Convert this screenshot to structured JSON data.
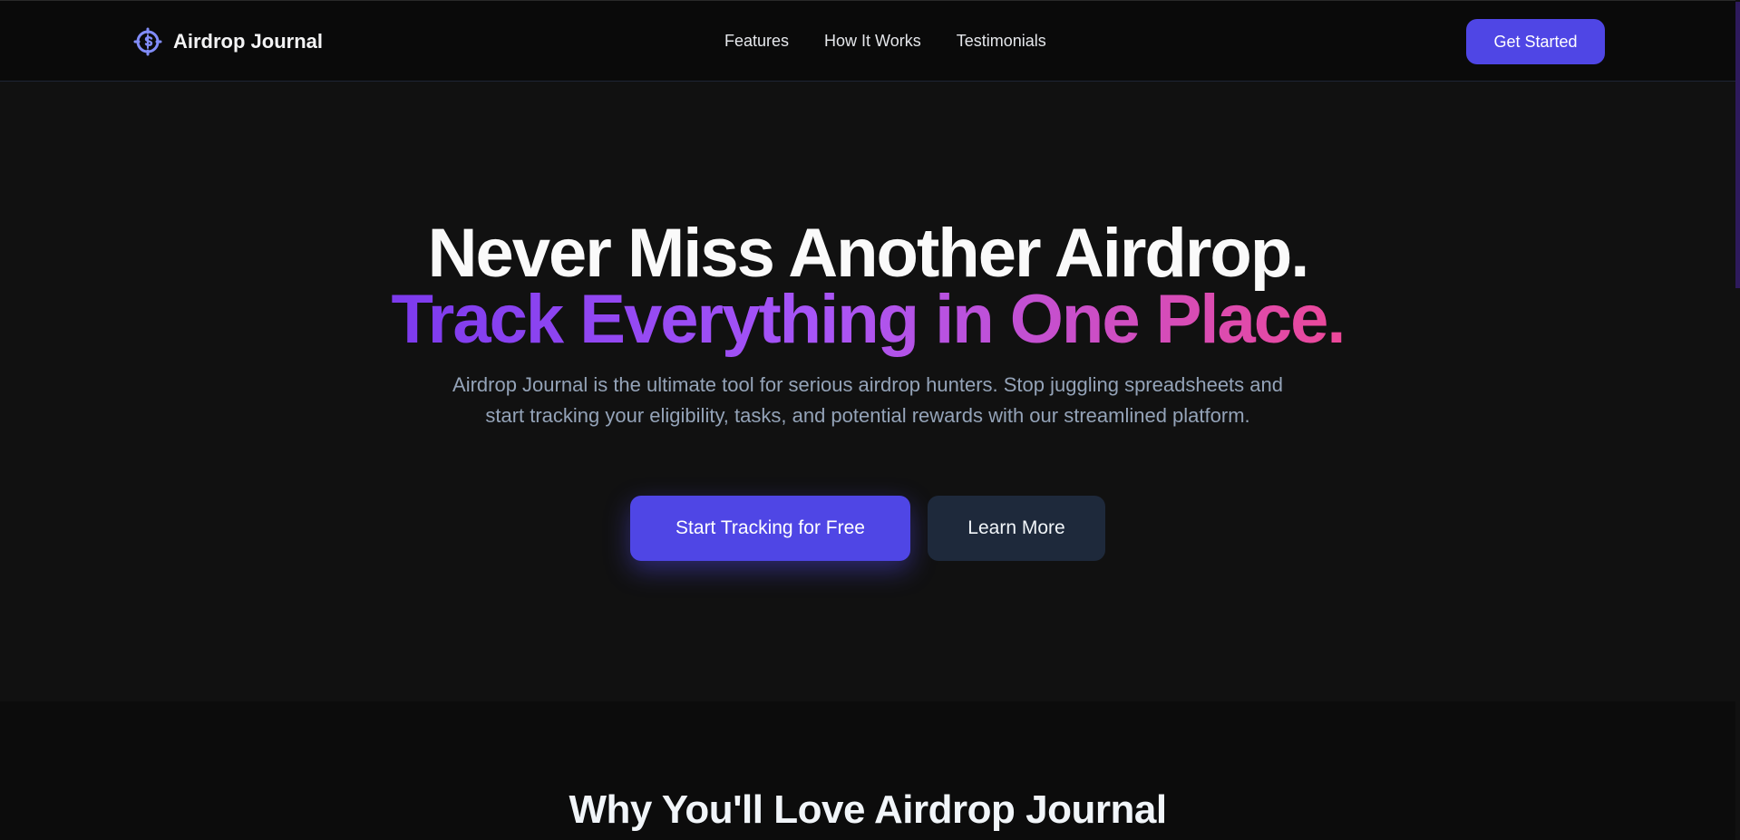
{
  "nav": {
    "brand": "Airdrop Journal",
    "logo_icon": "dollar-target-icon",
    "links": [
      "Features",
      "How It Works",
      "Testimonials"
    ],
    "cta": "Get Started"
  },
  "hero": {
    "title_line1": "Never Miss Another Airdrop.",
    "title_line2": "Track Everything in One Place.",
    "description": "Airdrop Journal is the ultimate tool for serious airdrop hunters. Stop juggling spreadsheets and start tracking your eligibility, tasks, and potential rewards with our streamlined platform.",
    "primary_button": "Start Tracking for Free",
    "secondary_button": "Learn More"
  },
  "features": {
    "heading": "Why You'll Love Airdrop Journal"
  },
  "colors": {
    "accent": "#4f46e5",
    "gradient_start": "#7c3aed",
    "gradient_end": "#ec4899"
  }
}
